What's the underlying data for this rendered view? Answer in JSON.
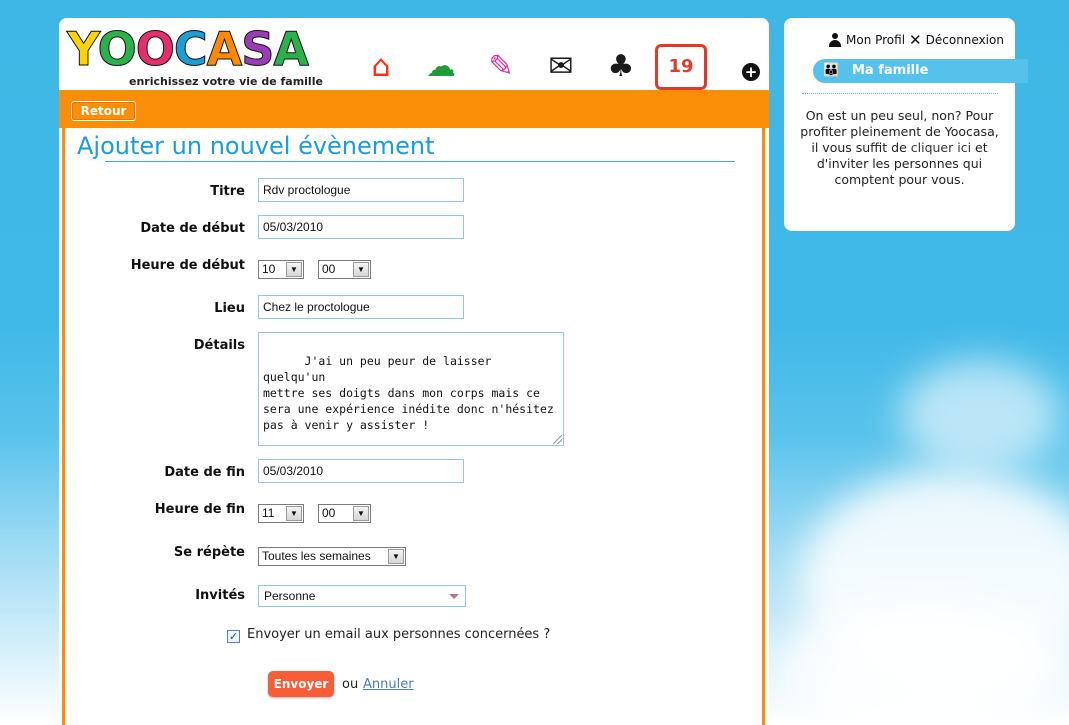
{
  "header": {
    "logo": [
      "Y",
      "O",
      "O",
      "C",
      "A",
      "S",
      "A"
    ],
    "logo_colors": [
      "#ffd400",
      "#2ab24a",
      "#e52e6a",
      "#1d9ed8",
      "#ff8a00",
      "#9b3bb5",
      "#2ab24a"
    ],
    "tagline": "enrichissez votre vie de famille",
    "nav_icons": [
      {
        "name": "home-icon",
        "glyph": "⌂",
        "color": "#ff2d1a"
      },
      {
        "name": "photos-icon",
        "glyph": "☁",
        "color": "#1f9b3a"
      },
      {
        "name": "notes-icon",
        "glyph": "✎",
        "color": "#e0309a"
      },
      {
        "name": "mail-icon",
        "glyph": "✉",
        "color": "#1a1a1a"
      },
      {
        "name": "cards-icon",
        "glyph": "♣",
        "color": "#1a1a1a"
      },
      {
        "name": "calendar-icon",
        "glyph": "19",
        "color": "#e23a2a"
      }
    ],
    "plus": "+"
  },
  "toolbar": {
    "back_label": "Retour"
  },
  "form": {
    "title": "Ajouter un nouvel évènement",
    "titre_label": "Titre",
    "titre_value": "Rdv proctologue",
    "date_debut_label": "Date de début",
    "date_debut_value": "05/03/2010",
    "heure_debut_label": "Heure de début",
    "heure_debut_h": "10",
    "heure_debut_m": "00",
    "lieu_label": "Lieu",
    "lieu_value": "Chez le proctologue",
    "details_label": "Détails",
    "details_value": "J'ai un peu peur de laisser quelqu'un\nmettre ses doigts dans mon corps mais ce\nsera une expérience inédite donc n'hésitez\npas à venir y assister !",
    "date_fin_label": "Date de fin",
    "date_fin_value": "05/03/2010",
    "heure_fin_label": "Heure de fin",
    "heure_fin_h": "11",
    "heure_fin_m": "00",
    "repete_label": "Se répète",
    "repete_value": "Toutes les semaines",
    "invites_label": "Invités",
    "invites_value": "Personne",
    "email_label": "Envoyer un email aux personnes concernées ?",
    "send_label": "Envoyer",
    "ou": "ou",
    "cancel_label": "Annuler"
  },
  "side": {
    "profile_label": "Mon Profil",
    "logout_label": "Déconnexion",
    "family_label": "Ma famille",
    "text_before": "On est un peu seul, non? Pour profiter pleinement de Yoocasa, il vous suffit de ",
    "link_label": "cliquer ici",
    "text_after": " et d'inviter les personnes qui comptent pour vous."
  },
  "colors": {
    "accent_orange": "#fb8e07",
    "accent_blue": "#1a9ed9",
    "send_red": "#f75d37"
  }
}
